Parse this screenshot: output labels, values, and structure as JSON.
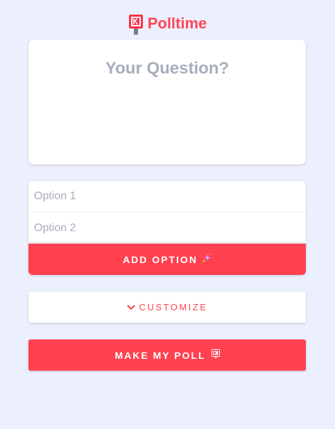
{
  "app": {
    "brand": "Polltime"
  },
  "question": {
    "placeholder": "Your Question?",
    "value": ""
  },
  "options": [
    {
      "placeholder": "Option 1",
      "value": ""
    },
    {
      "placeholder": "Option 2",
      "value": ""
    }
  ],
  "buttons": {
    "add_option": "ADD OPTION",
    "customize": "CUSTOMIZE",
    "make_poll": "MAKE MY POLL"
  },
  "icons": {
    "logo": "polltime-logo-icon",
    "add_option": "sparkles-icon",
    "customize": "chevron-down-icon",
    "make_poll": "polltime-logo-icon"
  },
  "colors": {
    "background": "#eceffd",
    "accent": "#ff4150",
    "placeholder": "#a8adbd",
    "card": "#ffffff"
  }
}
